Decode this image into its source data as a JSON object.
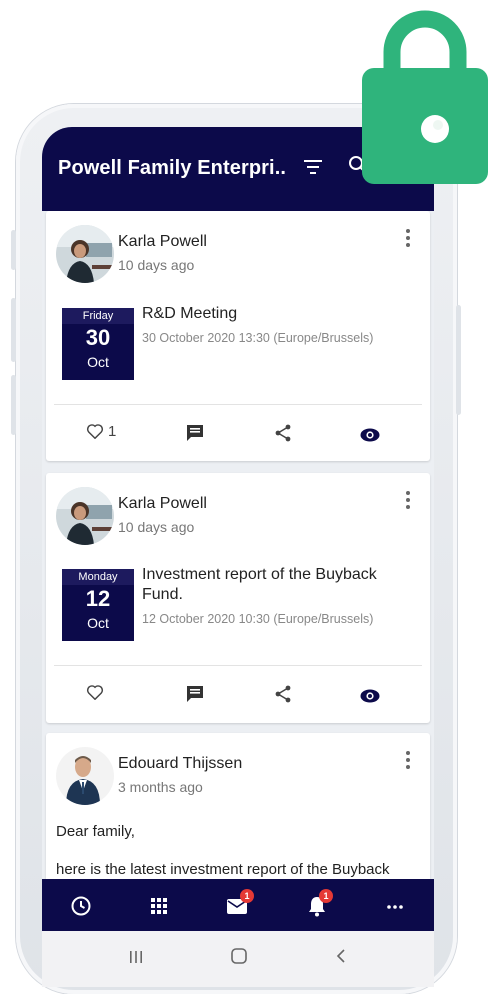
{
  "app": {
    "title": "Powell Family Enterpri.."
  },
  "posts": [
    {
      "author": "Karla Powell",
      "time": "10 days ago",
      "event": {
        "weekday": "Friday",
        "day": "30",
        "month": "Oct",
        "title": "R&D Meeting",
        "datetime": "30 October 2020 13:30 (Europe/Brussels)"
      },
      "likes": "1"
    },
    {
      "author": "Karla Powell",
      "time": "10 days ago",
      "event": {
        "weekday": "Monday",
        "day": "12",
        "month": "Oct",
        "title": "Investment report of the Buyback Fund.",
        "datetime": "12 October 2020 10:30 (Europe/Brussels)"
      },
      "likes": ""
    },
    {
      "author": "Edouard Thijssen",
      "time": "3 months ago",
      "greeting": "Dear family,",
      "body": "here is the latest investment report of the Buyback"
    }
  ],
  "bottom_nav": {
    "items": [
      "clock-icon",
      "apps-grid-icon",
      "mail-icon",
      "bell-icon",
      "more-horizontal-icon"
    ],
    "mail_badge": "1",
    "bell_badge": "1"
  },
  "colors": {
    "primary": "#0c0a4a",
    "accent_lock": "#2fb47c",
    "badge": "#e53935"
  }
}
